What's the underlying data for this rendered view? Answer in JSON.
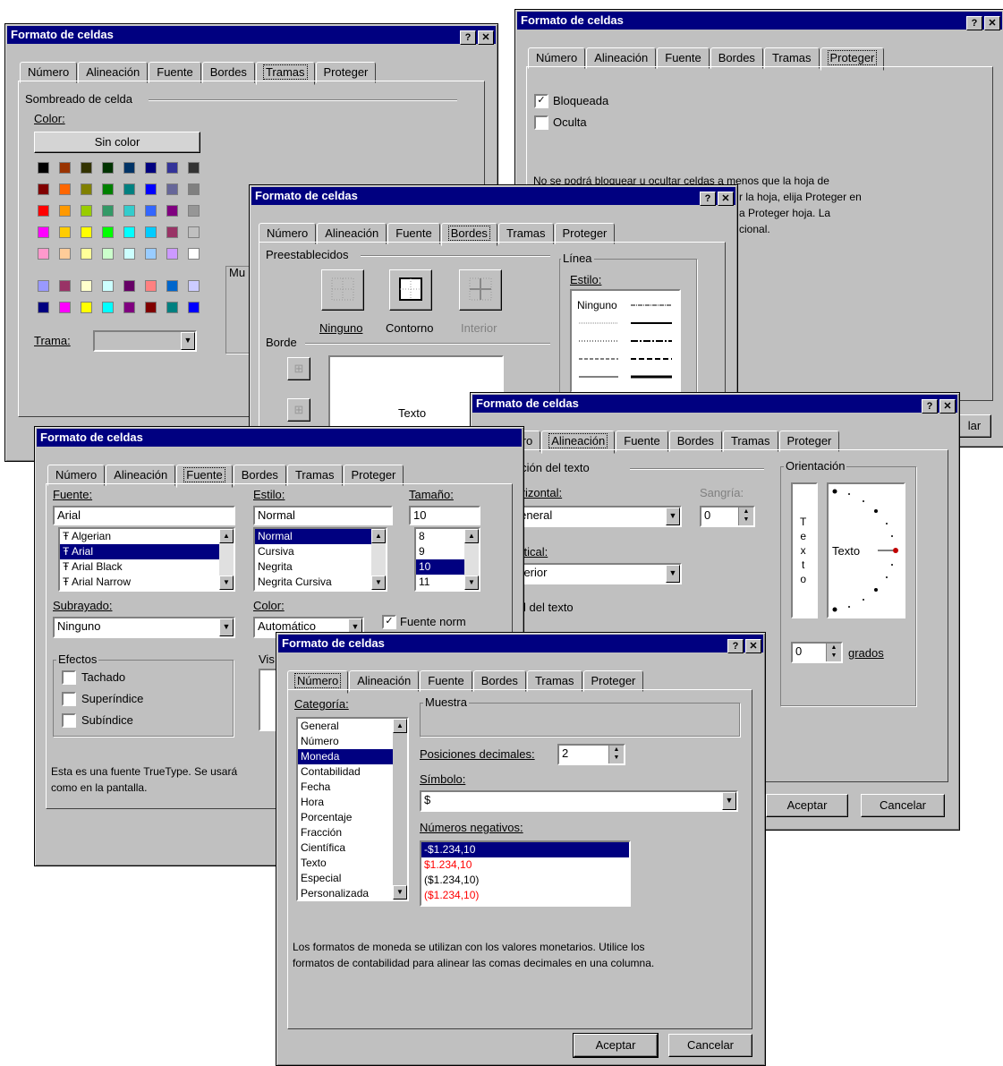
{
  "dialog_title": "Formato de celdas",
  "help_btn": "?",
  "close_btn": "✕",
  "tabs": [
    "Número",
    "Alineación",
    "Fuente",
    "Bordes",
    "Tramas",
    "Proteger"
  ],
  "tramas": {
    "section": "Sombreado de celda",
    "color_label": "Color:",
    "no_color": "Sin color",
    "trama_label": "Trama:",
    "muestra_partial": "Mu",
    "colors": [
      [
        "#000000",
        "#993300",
        "#333300",
        "#003300",
        "#003366",
        "#000080",
        "#333399",
        "#333333"
      ],
      [
        "#800000",
        "#ff6600",
        "#808000",
        "#008000",
        "#008080",
        "#0000ff",
        "#666699",
        "#808080"
      ],
      [
        "#ff0000",
        "#ff9900",
        "#99cc00",
        "#339966",
        "#33cccc",
        "#3366ff",
        "#800080",
        "#969696"
      ],
      [
        "#ff00ff",
        "#ffcc00",
        "#ffff00",
        "#00ff00",
        "#00ffff",
        "#00ccff",
        "#993366",
        "#c0c0c0"
      ],
      [
        "#ff99cc",
        "#ffcc99",
        "#ffff99",
        "#ccffcc",
        "#ccffff",
        "#99ccff",
        "#cc99ff",
        "#ffffff"
      ],
      [
        "#9999ff",
        "#993366",
        "#ffffcc",
        "#ccffff",
        "#660066",
        "#ff8080",
        "#0066cc",
        "#ccccff"
      ],
      [
        "#000080",
        "#ff00ff",
        "#ffff00",
        "#00ffff",
        "#800080",
        "#800000",
        "#008080",
        "#0000ff"
      ]
    ]
  },
  "proteger": {
    "bloqueada": "Bloqueada",
    "oculta": "Oculta",
    "note_lines": [
      "No se podrá bloquear u ocultar celdas a menos que la hoja de",
      "r la hoja, elija Proteger en",
      "a Proteger hoja. La",
      "cional."
    ],
    "aceptar_partial": "lar"
  },
  "bordes": {
    "preestablecidos": "Preestablecidos",
    "ninguno": "Ninguno",
    "contorno": "Contorno",
    "interior": "Interior",
    "borde": "Borde",
    "texto": "Texto",
    "linea": "Línea",
    "estilo": "Estilo:",
    "estilo_ninguno": "Ninguno"
  },
  "alineacion": {
    "alineacion_texto": "Alineación del texto",
    "horizontal": "Horizontal:",
    "horizontal_value": "General",
    "sangria": "Sangría:",
    "sangria_value": "0",
    "vertical": "Vertical:",
    "vertical_value": "Inferior",
    "control_texto": "Control del texto",
    "orientacion": "Orientación",
    "vertical_text": [
      "T",
      "e",
      "x",
      "t",
      "o"
    ],
    "texto": "Texto",
    "grados_value": "0",
    "grados": "grados",
    "aceptar": "Aceptar",
    "cancelar": "Cancelar"
  },
  "fuente": {
    "fuente_label": "Fuente:",
    "fuente_value": "Arial",
    "fonts": [
      "Algerian",
      "Arial",
      "Arial Black",
      "Arial Narrow"
    ],
    "estilo_label": "Estilo:",
    "estilo_value": "Normal",
    "estilos": [
      "Normal",
      "Cursiva",
      "Negrita",
      "Negrita Cursiva"
    ],
    "tamano_label": "Tamaño:",
    "tamano_value": "10",
    "tamanos": [
      "8",
      "9",
      "10",
      "11"
    ],
    "subrayado_label": "Subrayado:",
    "subrayado_value": "Ninguno",
    "color_label": "Color:",
    "color_value": "Automático",
    "fuente_normal": "Fuente norm",
    "efectos": "Efectos",
    "tachado": "Tachado",
    "superindice": "Superíndice",
    "subindice": "Subíndice",
    "vista_partial": "Vis",
    "note_1": "Esta es una fuente TrueType. Se usará",
    "note_2": "como en la pantalla."
  },
  "numero": {
    "categoria": "Categoría:",
    "categories": [
      "General",
      "Número",
      "Moneda",
      "Contabilidad",
      "Fecha",
      "Hora",
      "Porcentaje",
      "Fracción",
      "Científica",
      "Texto",
      "Especial",
      "Personalizada"
    ],
    "muestra": "Muestra",
    "posiciones": "Posiciones decimales:",
    "posiciones_value": "2",
    "simbolo": "Símbolo:",
    "simbolo_value": "$",
    "negativos": "Números negativos:",
    "negatives": [
      "-$1.234,10",
      "$1.234,10",
      "($1.234,10)",
      "($1.234,10)"
    ],
    "description_1": "Los formatos de moneda se utilizan con los valores monetarios. Utilice los",
    "description_2": "formatos de contabilidad para alinear las comas decimales en una columna.",
    "aceptar": "Aceptar",
    "cancelar": "Cancelar"
  }
}
